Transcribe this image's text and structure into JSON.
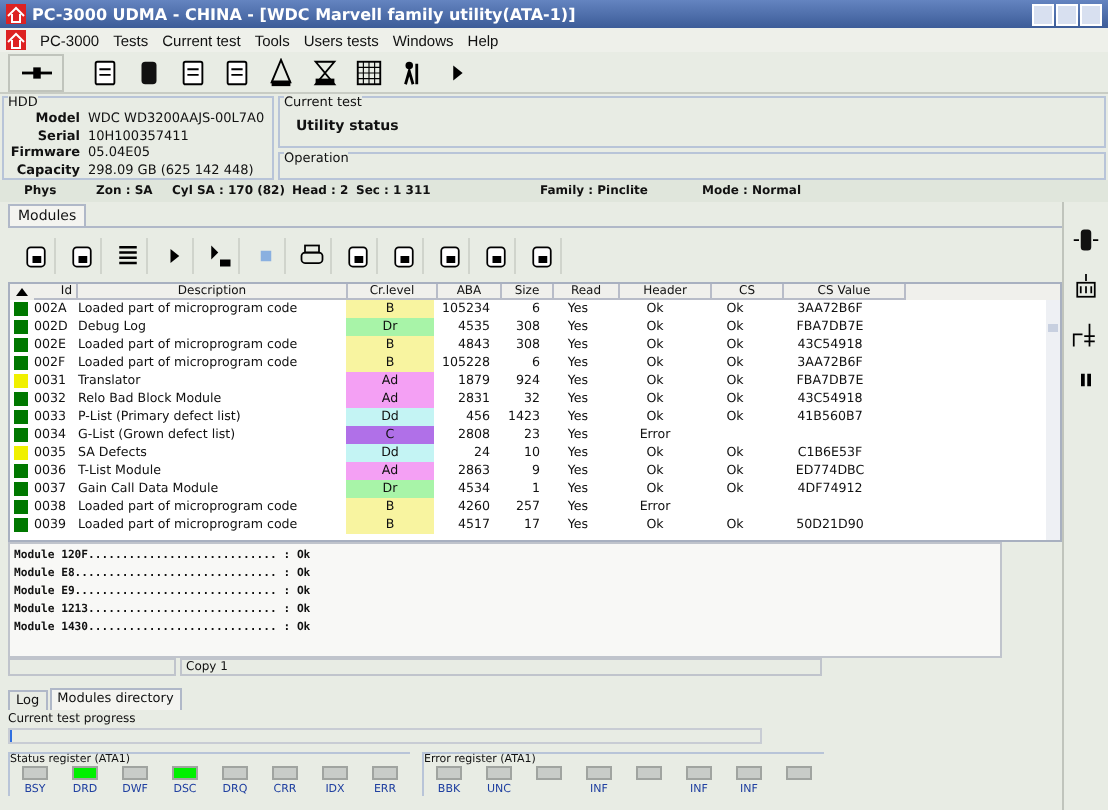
{
  "window": {
    "title": "PC-3000 UDMA - CHINA - [WDC Marvell family utility(ATA-1)]"
  },
  "menu": [
    "PC-3000",
    "Tests",
    "Current test",
    "Tools",
    "Users tests",
    "Windows",
    "Help"
  ],
  "hdd": {
    "heading": "HDD",
    "fields": [
      {
        "label": "Model",
        "value": "WDC WD3200AAJS-00L7A0"
      },
      {
        "label": "Serial",
        "value": "10H100357411"
      },
      {
        "label": "Firmware",
        "value": "05.04E05"
      },
      {
        "label": "Capacity",
        "value": "298.09 GB (625 142 448)"
      }
    ]
  },
  "current_test": {
    "heading": "Current test",
    "value": "Utility status"
  },
  "operation": {
    "heading": "Operation"
  },
  "status_line": [
    "Phys",
    "Zon : SA",
    "Cyl SA : 170 (82)",
    "Head : 2",
    "Sec : 1 311",
    "Family : Pinclite",
    "Mode : Normal"
  ],
  "modules_tab": {
    "label": "Modules",
    "selected": true
  },
  "table": {
    "columns": [
      "Id",
      "Description",
      "Cr.level",
      "ABA",
      "Size",
      "Read",
      "Header",
      "CS",
      "CS Value"
    ],
    "rows": [
      {
        "color": "#007800",
        "cells": [
          "002A",
          "Loaded part of microprogram code",
          {
            "text": "B",
            "color": "#f8f4a0"
          },
          "105234",
          "6",
          "Yes",
          "Ok",
          "Ok",
          "3AA72B6F"
        ]
      },
      {
        "color": "#007800",
        "cells": [
          "002D",
          "Debug Log",
          {
            "text": "Dr",
            "color": "#a8f4a8"
          },
          "4535",
          "308",
          "Yes",
          "Ok",
          "Ok",
          "FBA7DB7E"
        ]
      },
      {
        "color": "#007800",
        "cells": [
          "002E",
          "Loaded part of microprogram code",
          {
            "text": "B",
            "color": "#f8f4a0"
          },
          "4843",
          "308",
          "Yes",
          "Ok",
          "Ok",
          "43C54918"
        ]
      },
      {
        "color": "#007800",
        "cells": [
          "002F",
          "Loaded part of microprogram code",
          {
            "text": "B",
            "color": "#f8f4a0"
          },
          "105228",
          "6",
          "Yes",
          "Ok",
          "Ok",
          "3AA72B6F"
        ]
      },
      {
        "color": "#f0f000",
        "cells": [
          "0031",
          "Translator",
          {
            "text": "Ad",
            "color": "#f4a0f4"
          },
          "1879",
          "924",
          "Yes",
          "Ok",
          "Ok",
          "FBA7DB7E"
        ]
      },
      {
        "color": "#007800",
        "cells": [
          "0032",
          "Relo Bad Block Module",
          {
            "text": "Ad",
            "color": "#f4a0f4"
          },
          "2831",
          "32",
          "Yes",
          "Ok",
          "Ok",
          "43C54918"
        ]
      },
      {
        "color": "#007800",
        "cells": [
          "0033",
          "P-List (Primary defect list)",
          {
            "text": "Dd",
            "color": "#c4f4f4"
          },
          "456",
          "1423",
          "Yes",
          "Ok",
          "Ok",
          "41B560B7"
        ]
      },
      {
        "color": "#007800",
        "cells": [
          "0034",
          "G-List (Grown defect list)",
          {
            "text": "C",
            "color": "#b070e8"
          },
          "2808",
          "23",
          "Yes",
          "Error",
          "",
          ""
        ]
      },
      {
        "color": "#f0f000",
        "cells": [
          "0035",
          "SA Defects",
          {
            "text": "Dd",
            "color": "#c4f4f4"
          },
          "24",
          "10",
          "Yes",
          "Ok",
          "Ok",
          "C1B6E53F"
        ]
      },
      {
        "color": "#007800",
        "cells": [
          "0036",
          "T-List Module",
          {
            "text": "Ad",
            "color": "#f4a0f4"
          },
          "2863",
          "9",
          "Yes",
          "Ok",
          "Ok",
          "ED774DBC"
        ]
      },
      {
        "color": "#007800",
        "cells": [
          "0037",
          "Gain Call Data Module",
          {
            "text": "Dr",
            "color": "#a8f4a8"
          },
          "4534",
          "1",
          "Yes",
          "Ok",
          "Ok",
          "4DF74912"
        ]
      },
      {
        "color": "#007800",
        "cells": [
          "0038",
          "Loaded part of microprogram code",
          {
            "text": "B",
            "color": "#f8f4a0"
          },
          "4260",
          "257",
          "Yes",
          "Error",
          "",
          ""
        ]
      },
      {
        "color": "#007800",
        "cells": [
          "0039",
          "Loaded part of microprogram code",
          {
            "text": "B",
            "color": "#f8f4a0"
          },
          "4517",
          "17",
          "Yes",
          "Ok",
          "Ok",
          "50D21D90"
        ]
      }
    ]
  },
  "log": [
    "Module 120F............................ : Ok",
    "Module E8.............................. : Ok",
    "Module E9.............................. : Ok",
    "Module 1213............................ : Ok",
    "Module 1430............................ : Ok"
  ],
  "copy_label": "Copy 1",
  "bottom_tabs": [
    {
      "label": "Log",
      "selected": false
    },
    {
      "label": "Modules directory",
      "selected": true
    }
  ],
  "progress_label": "Current test progress",
  "progress": {
    "level": 0
  },
  "status_register": {
    "title": "Status register (ATA1)",
    "leds": [
      {
        "label": "BSY",
        "on": false
      },
      {
        "label": "DRD",
        "on": true
      },
      {
        "label": "DWF",
        "on": false
      },
      {
        "label": "DSC",
        "on": true
      },
      {
        "label": "DRQ",
        "on": false
      },
      {
        "label": "CRR",
        "on": false
      },
      {
        "label": "IDX",
        "on": false
      },
      {
        "label": "ERR",
        "on": false
      }
    ]
  },
  "error_register": {
    "title": "Error register (ATA1)",
    "leds": [
      {
        "label": "BBK",
        "on": false
      },
      {
        "label": "UNC",
        "on": false
      },
      {
        "on": false
      },
      {
        "label": "INF",
        "on": false
      },
      {
        "on": false
      },
      {
        "label": "INF",
        "on": false
      },
      {
        "label": "INF",
        "on": false
      },
      {
        "on": false
      }
    ]
  }
}
